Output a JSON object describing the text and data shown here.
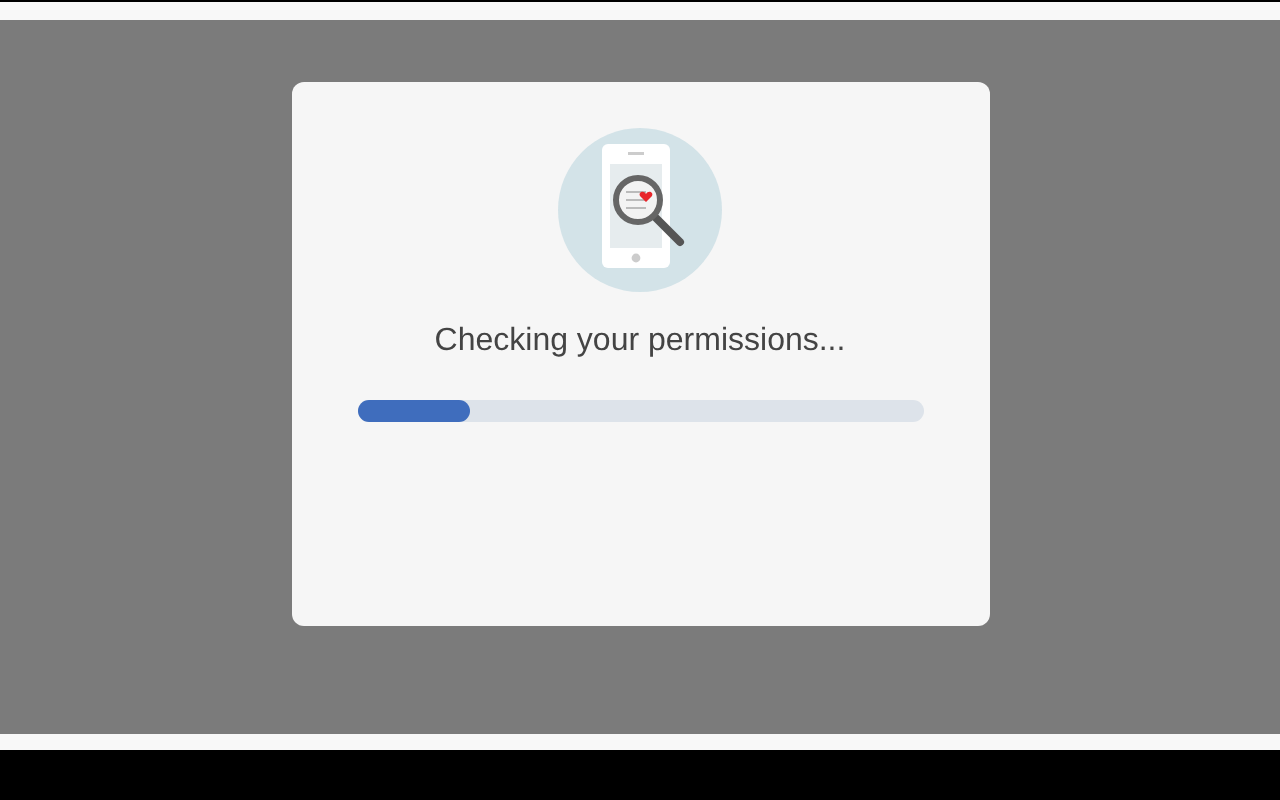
{
  "dialog": {
    "message": "Checking your permissions...",
    "progress": {
      "level": 0.2
    }
  }
}
